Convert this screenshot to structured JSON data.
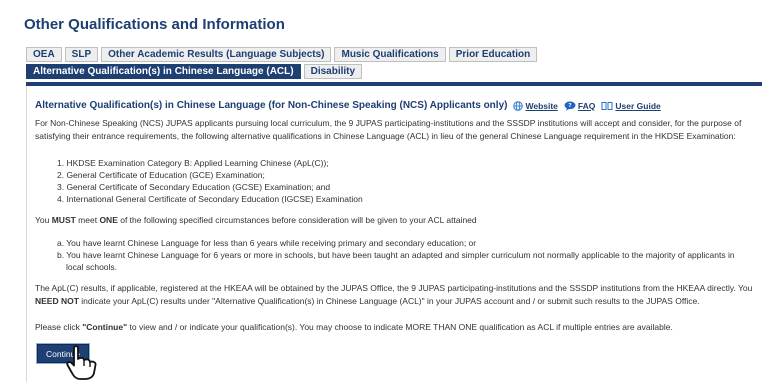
{
  "page_title": "Other Qualifications and Information",
  "tabs": [
    {
      "label": "OEA",
      "active": false
    },
    {
      "label": "SLP",
      "active": false
    },
    {
      "label": "Other Academic Results (Language Subjects)",
      "active": false
    },
    {
      "label": "Music Qualifications",
      "active": false
    },
    {
      "label": "Prior Education",
      "active": false
    },
    {
      "label": "Alternative Qualification(s) in Chinese Language (ACL)",
      "active": true
    },
    {
      "label": "Disability",
      "active": false
    }
  ],
  "section": {
    "heading": "Alternative Qualification(s) in Chinese Language (for Non-Chinese Speaking (NCS) Applicants only)",
    "links": {
      "website": "Website",
      "faq": "FAQ",
      "user_guide": "User Guide"
    },
    "intro": "For Non-Chinese Speaking (NCS) JUPAS applicants pursuing local curriculum, the 9 JUPAS participating-institutions and the SSSDP institutions will accept and consider, for the purpose of satisfying their entrance requirements, the following alternative qualifications in Chinese Language (ACL) in lieu of the general Chinese Language requirement in the HKDSE Examination:",
    "qualifications": [
      "1. HKDSE Examination Category B: Applied Learning Chinese (ApL(C));",
      "2. General Certificate of Education (GCE) Examination;",
      "3. General Certificate of Secondary Education (GCSE) Examination; and",
      "4. International General Certificate of Secondary Education (IGCSE) Examination"
    ],
    "must_pre": "You ",
    "must_bold1": "MUST",
    "must_mid": " meet ",
    "must_bold2": "ONE",
    "must_post": " of the following specified circumstances before consideration will be given to your ACL attained",
    "circumstance_a": "a. You have learnt Chinese Language for less than 6 years while receiving primary and secondary education; or",
    "circumstance_b1": "b. You have learnt Chinese Language for 6 years or more in schools, but have been taught an adapted and simpler curriculum not normally applicable to the majority of applicants in",
    "circumstance_b2": "local schools.",
    "aplc_pre": "The ApL(C) results, if applicable, registered at the HKEAA will be obtained by the JUPAS Office, the 9 JUPAS participating-institutions and the SSSDP institutions from the HKEAA directly. You ",
    "aplc_bold": "NEED NOT",
    "aplc_post": " indicate your ApL(C) results under \"Alternative Qualification(s) in Chinese Language (ACL)\" in your JUPAS account and / or submit such results to the JUPAS Office.",
    "click_pre": "Please click ",
    "click_bold": "\"Continue\"",
    "click_post": " to view and / or indicate your qualification(s). You may choose to indicate MORE THAN ONE qualification as ACL if multiple entries are available.",
    "continue_label": "Continue"
  },
  "colors": {
    "brand": "#1d3f72",
    "tab_bg": "#eeeeee"
  }
}
